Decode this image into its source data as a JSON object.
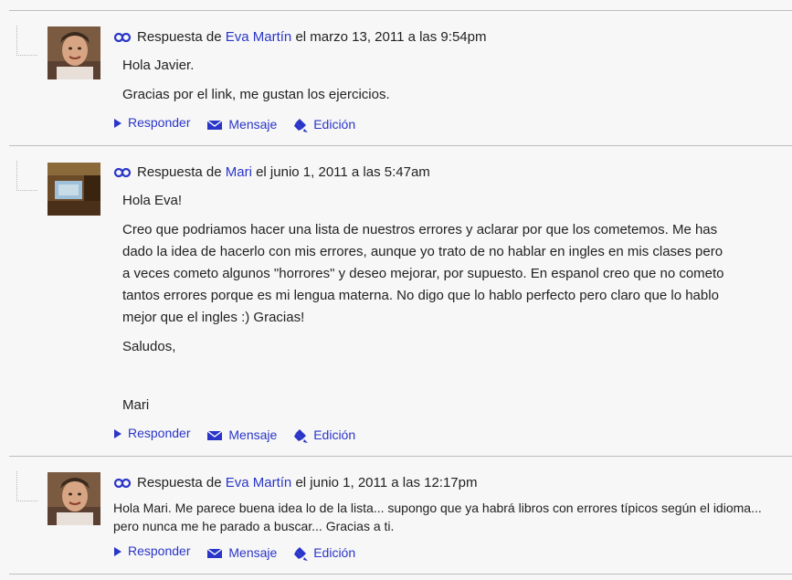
{
  "replies": [
    {
      "prefix": "Respuesta de",
      "author": "Eva Martín",
      "date": "el marzo 13, 2011 a las 9:54pm",
      "avatar": "avatar-eva",
      "paragraphs": [
        "Hola Javier.",
        "Gracias por el link, me gustan los ejercicios."
      ],
      "actions": {
        "reply": "Responder",
        "message": "Mensaje",
        "edit": "Edición"
      }
    },
    {
      "prefix": "Respuesta de",
      "author": "Mari",
      "date": "el junio 1, 2011 a las 5:47am",
      "avatar": "avatar-mari",
      "paragraphs": [
        "Hola Eva!",
        "Creo que podriamos hacer una lista de nuestros errores y aclarar por que los cometemos. Me has dado la idea de hacerlo con mis errores, aunque yo trato de no hablar en ingles en mis clases pero a veces cometo algunos \"horrores\" y deseo mejorar, por supuesto.  En espanol creo que no cometo tantos errores porque es mi lengua materna. No digo que lo hablo perfecto pero claro que lo hablo mejor que el ingles :) Gracias!",
        "Saludos,",
        "Mari"
      ],
      "actions": {
        "reply": "Responder",
        "message": "Mensaje",
        "edit": "Edición"
      }
    },
    {
      "prefix": "Respuesta de",
      "author": "Eva Martín",
      "date": "el junio 1, 2011 a las 12:17pm",
      "avatar": "avatar-eva",
      "paragraphs": [
        "Hola Mari. Me parece buena idea lo de la lista... supongo que ya habrá libros con errores típicos según el idioma... pero nunca me he parado a buscar... Gracias a ti."
      ],
      "actions": {
        "reply": "Responder",
        "message": "Mensaje",
        "edit": "Edición"
      }
    }
  ],
  "colors": {
    "link": "#2a36c8",
    "text": "#222222",
    "divider": "#bdbdbd",
    "background": "#f7f7f7"
  }
}
